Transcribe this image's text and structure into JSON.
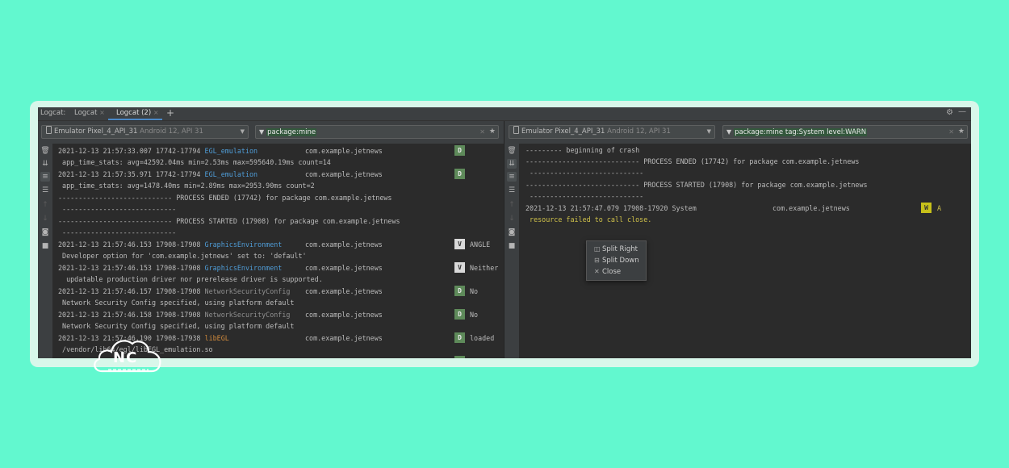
{
  "tabbar": {
    "label": "Logcat:",
    "tabs": [
      {
        "label": "Logcat",
        "close": "×"
      },
      {
        "label": "Logcat (2)",
        "close": "×"
      }
    ],
    "add": "+",
    "settings_icon": "gear-icon",
    "minimize_icon": "minimize-icon"
  },
  "left_pane": {
    "device": {
      "name": "Emulator Pixel_4_API_31",
      "detail": "Android 12, API 31"
    },
    "filter": "package:mine",
    "rows": [
      {
        "text": "2021-12-13 21:57:33.007 17742-17794 ",
        "tag": "EGL_emulation",
        "tag_color": "blue",
        "pkg": "com.example.jetnews",
        "level": "D",
        "msg": ""
      },
      {
        "text": " app_time_stats: avg=42592.04ms min=2.53ms max=595640.19ms count=14"
      },
      {
        "text": "2021-12-13 21:57:35.971 17742-17794 ",
        "tag": "EGL_emulation",
        "tag_color": "blue",
        "pkg": "com.example.jetnews",
        "level": "D",
        "msg": ""
      },
      {
        "text": " app_time_stats: avg=1478.40ms min=2.89ms max=2953.90ms count=2"
      },
      {
        "text": "---------------------------- PROCESS ENDED (17742) for package com.example.jetnews"
      },
      {
        "text": " ----------------------------"
      },
      {
        "text": "---------------------------- PROCESS STARTED (17908) for package com.example.jetnews"
      },
      {
        "text": " ----------------------------"
      },
      {
        "text": "2021-12-13 21:57:46.153 17908-17908 ",
        "tag": "GraphicsEnvironment",
        "tag_color": "blue",
        "pkg": "com.example.jetnews",
        "level": "V",
        "msg": "ANGLE"
      },
      {
        "text": " Developer option for 'com.example.jetnews' set to: 'default'"
      },
      {
        "text": "2021-12-13 21:57:46.153 17908-17908 ",
        "tag": "GraphicsEnvironment",
        "tag_color": "blue",
        "pkg": "com.example.jetnews",
        "level": "V",
        "msg": "Neither"
      },
      {
        "text": "  updatable production driver nor prerelease driver is supported."
      },
      {
        "text": "2021-12-13 21:57:46.157 17908-17908 ",
        "tag": "NetworkSecurityConfig",
        "tag_color": "gray",
        "pkg": "com.example.jetnews",
        "level": "D",
        "msg": "No"
      },
      {
        "text": " Network Security Config specified, using platform default"
      },
      {
        "text": "2021-12-13 21:57:46.158 17908-17908 ",
        "tag": "NetworkSecurityConfig",
        "tag_color": "gray",
        "pkg": "com.example.jetnews",
        "level": "D",
        "msg": "No"
      },
      {
        "text": " Network Security Config specified, using platform default"
      },
      {
        "text": "2021-12-13 21:57:46.190 17908-17938 ",
        "tag": "libEGL",
        "tag_color": "orange",
        "pkg": "com.example.jetnews",
        "level": "D",
        "msg": "loaded"
      },
      {
        "text": " /vendor/lib64/egl/libEGL_emulation.so"
      }
    ]
  },
  "right_pane": {
    "device": {
      "name": "Emulator Pixel_4_API_31",
      "detail": "Android 12, API 31"
    },
    "filter": "package:mine tag:System level:WARN",
    "rows": [
      {
        "text": "--------- beginning of crash"
      },
      {
        "text": "---------------------------- PROCESS ENDED (17742) for package com.example.jetnews"
      },
      {
        "text": " ----------------------------"
      },
      {
        "text": "---------------------------- PROCESS STARTED (17908) for package com.example.jetnews"
      },
      {
        "text": " ----------------------------"
      },
      {
        "text": "2021-12-13 21:57:47.079 17908-17920 System",
        "pkg": "com.example.jetnews",
        "level": "W",
        "msg": "A"
      },
      {
        "text": " resource failed to call close.",
        "warn": true
      }
    ]
  },
  "context_menu": {
    "items": [
      {
        "icon": "split-right-icon",
        "label": "Split Right"
      },
      {
        "icon": "split-down-icon",
        "label": "Split Down"
      },
      {
        "icon": "close-icon",
        "label": "Close"
      }
    ]
  },
  "watermark": {
    "text": "NC"
  },
  "colors": {
    "background": "#62f8cf",
    "panel": "#2b2b2b",
    "toolbar": "#3c3f41",
    "accent": "#4a88c7",
    "debug": "#5e8a5a",
    "warn": "#c7c01a"
  }
}
